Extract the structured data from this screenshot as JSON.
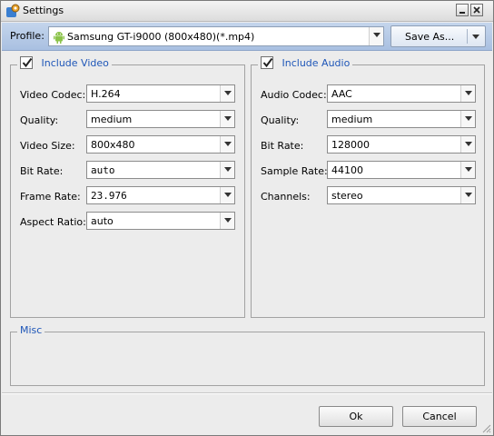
{
  "window": {
    "title": "Settings"
  },
  "toolbar": {
    "profile_label": "Profile:",
    "profile_value": "Samsung GT-i9000 (800x480)(*.mp4)",
    "save_as_label": "Save As..."
  },
  "video": {
    "legend": "Include Video",
    "checked": true,
    "rows": [
      {
        "label": "Video Codec:",
        "value": "H.264"
      },
      {
        "label": "Quality:",
        "value": "medium"
      },
      {
        "label": "Video Size:",
        "value": "800x480"
      },
      {
        "label": "Bit Rate:",
        "value": "auto"
      },
      {
        "label": "Frame Rate:",
        "value": "23.976"
      },
      {
        "label": "Aspect Ratio:",
        "value": "auto"
      }
    ]
  },
  "audio": {
    "legend": "Include Audio",
    "checked": true,
    "rows": [
      {
        "label": "Audio Codec:",
        "value": "AAC"
      },
      {
        "label": "Quality:",
        "value": "medium"
      },
      {
        "label": "Bit Rate:",
        "value": "128000"
      },
      {
        "label": "Sample Rate:",
        "value": "44100"
      },
      {
        "label": "Channels:",
        "value": "stereo"
      }
    ]
  },
  "misc": {
    "legend": "Misc"
  },
  "buttons": {
    "ok": "Ok",
    "cancel": "Cancel"
  },
  "colors": {
    "accent_text": "#1e56b8",
    "toolbar_bg": "#b7cbe7"
  },
  "icons": {
    "title": "settings-app-icon",
    "minimize": "minimize-icon",
    "close": "close-icon",
    "profile": "android-icon",
    "dropdown": "chevron-down-icon",
    "check": "checkmark-icon"
  }
}
